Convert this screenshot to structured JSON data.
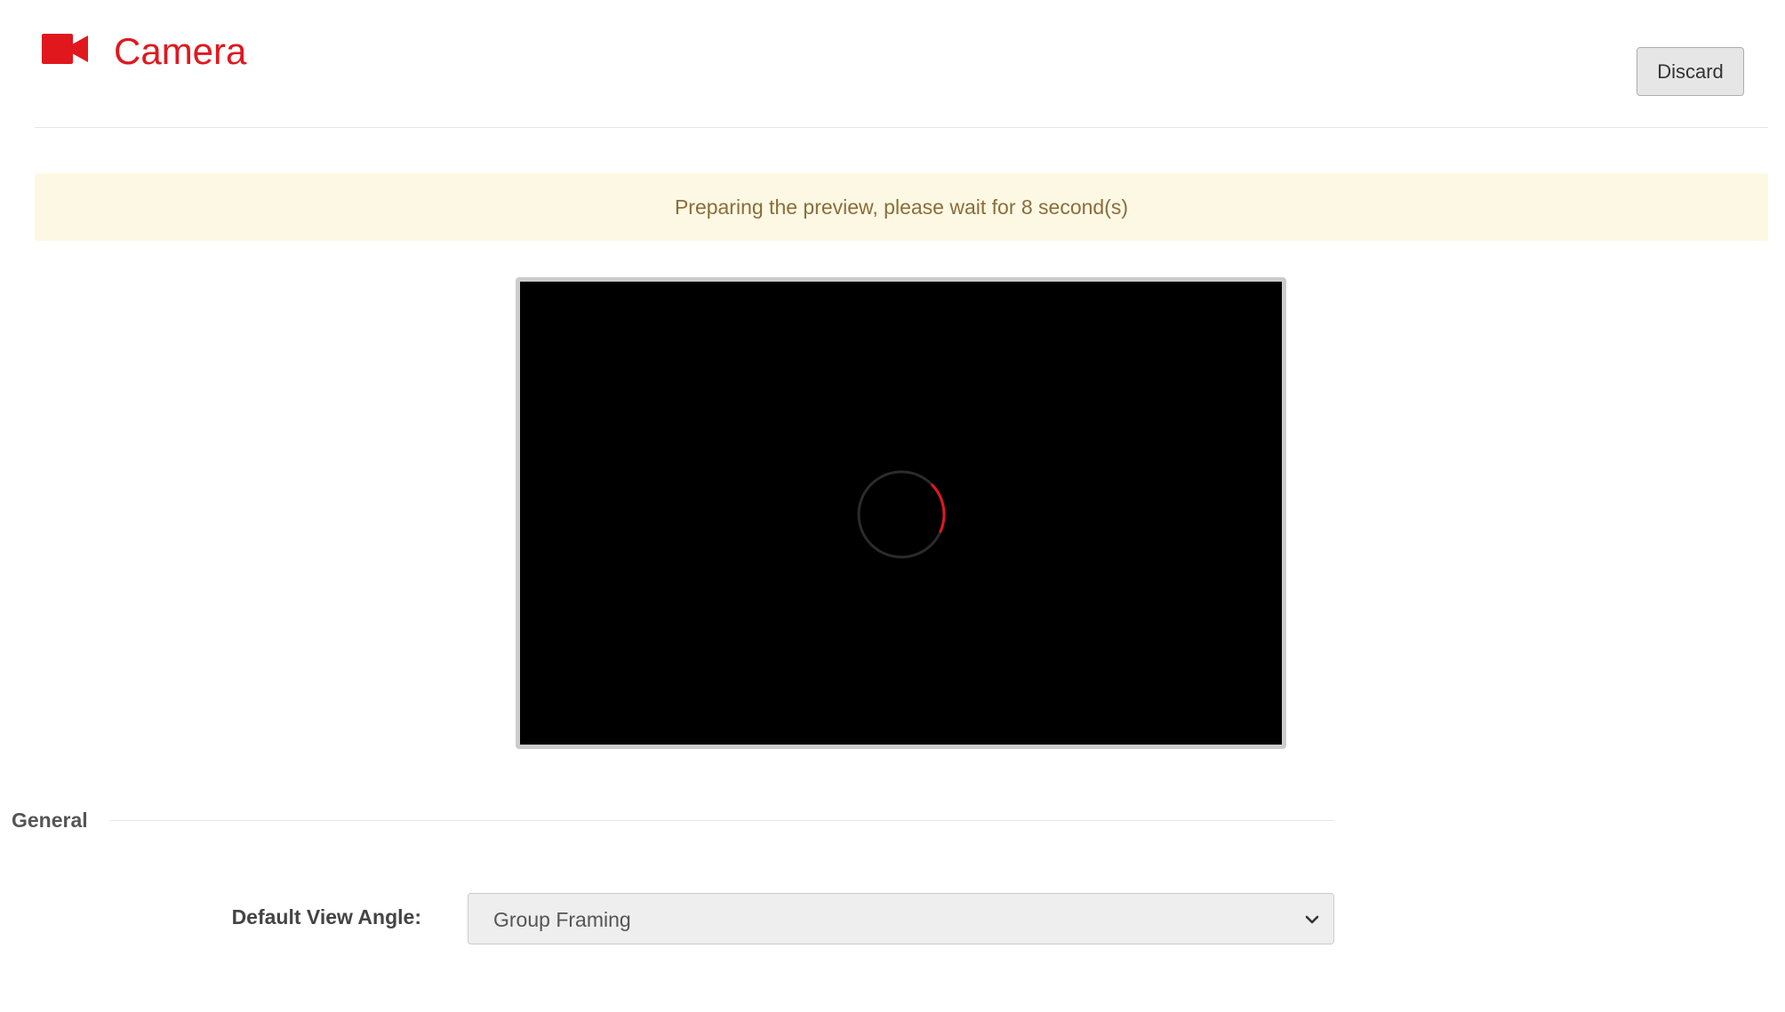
{
  "header": {
    "title": "Camera",
    "icon": "video-camera-icon",
    "accent_color": "#e0181e",
    "discard_label": "Discard"
  },
  "alert": {
    "message": "Preparing the preview, please wait for 8 second(s)",
    "countdown_seconds": 8,
    "background_color": "#fcf8e3",
    "text_color": "#8a6d3b"
  },
  "preview": {
    "state": "loading",
    "icon": "loading-spinner-icon",
    "spinner_color": "#e0181e"
  },
  "general": {
    "section_label": "General",
    "default_view_angle": {
      "label": "Default View Angle:",
      "selected": "Group Framing",
      "icon": "chevron-down-icon"
    }
  }
}
